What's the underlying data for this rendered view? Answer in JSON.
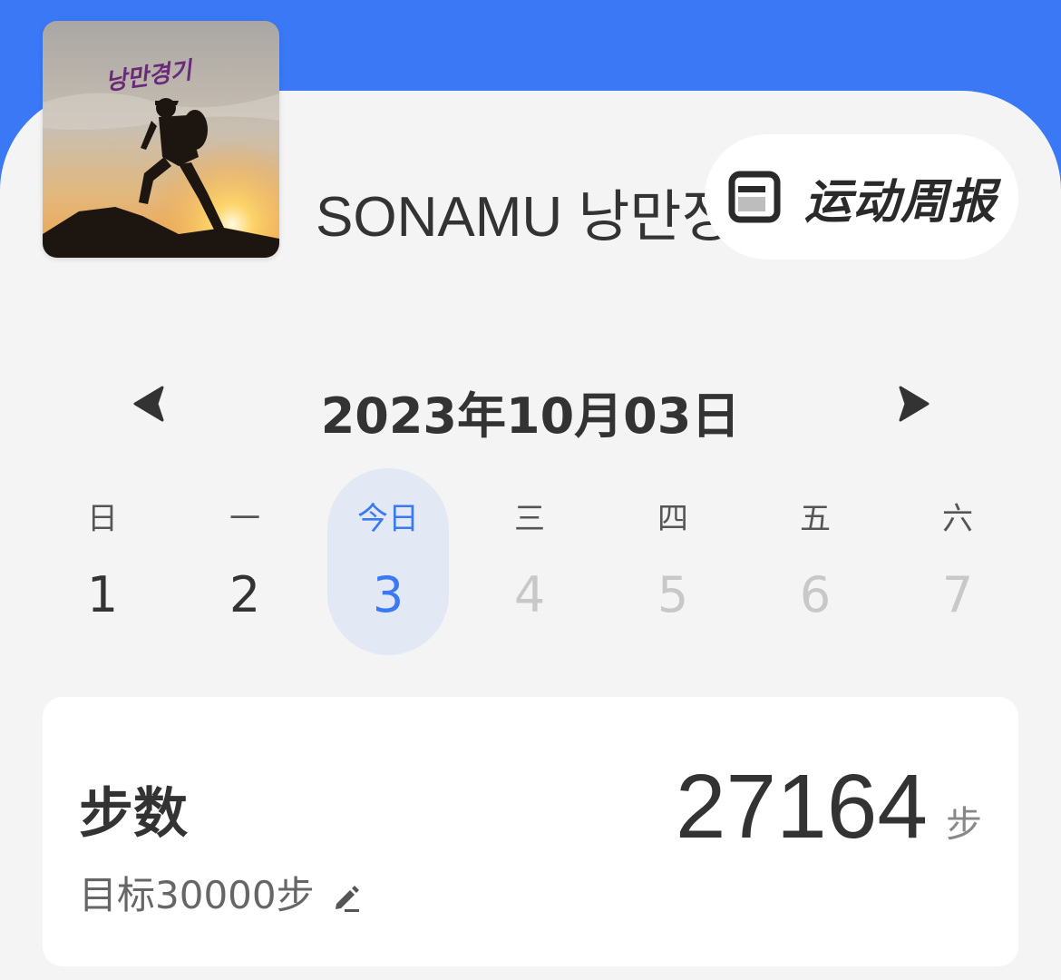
{
  "profile": {
    "username": "SONAMU 낭만정",
    "avatar_caption": "낭만경기"
  },
  "weekly_report": {
    "label": "运动周报",
    "icon": "document-icon"
  },
  "date_nav": {
    "title": "2023年10月03日",
    "prev_icon": "caret-left-icon",
    "next_icon": "caret-right-icon"
  },
  "week": [
    {
      "weekday": "日",
      "day": "1"
    },
    {
      "weekday": "一",
      "day": "2"
    },
    {
      "weekday": "今日",
      "day": "3"
    },
    {
      "weekday": "三",
      "day": "4"
    },
    {
      "weekday": "四",
      "day": "5"
    },
    {
      "weekday": "五",
      "day": "6"
    },
    {
      "weekday": "六",
      "day": "7"
    }
  ],
  "steps_card": {
    "title": "步数",
    "goal": "目标30000步",
    "value": "27164",
    "unit": "步",
    "edit_icon": "pencil-icon"
  },
  "colors": {
    "header_blue": "#3b78f6",
    "panel_bg": "#f4f4f4",
    "today_bg": "#e2e9f4",
    "accent": "#3b78f6",
    "future_text": "#c8c8c8"
  }
}
